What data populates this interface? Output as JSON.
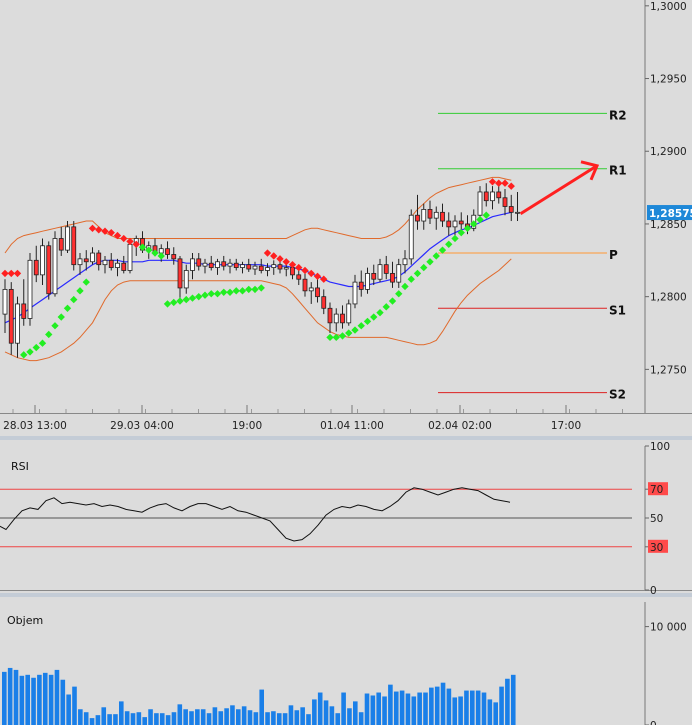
{
  "chart_data": [
    {
      "type": "candlestick",
      "panel": "price",
      "y_axis": {
        "ylim": [
          1.272,
          1.3004
        ],
        "ticks": [
          "1,3000",
          "1,2950",
          "1,2900",
          "1,2850",
          "1,2800",
          "1,2750"
        ],
        "grid": false
      },
      "x_axis": {
        "tick_labels": [
          "28.03 13:00",
          "29.03 04:00",
          "19:00",
          "01.04 11:00",
          "02.04 02:00",
          "17:00"
        ]
      },
      "current_price_label": "1,28575",
      "pivot_levels": [
        {
          "label": "R2",
          "value": 1.2926,
          "color": "#33cc33"
        },
        {
          "label": "R1",
          "value": 1.2888,
          "color": "#33cc33"
        },
        {
          "label": "P",
          "value": 1.283,
          "color": "#ff9933"
        },
        {
          "label": "S1",
          "value": 1.2792,
          "color": "#dd2222"
        },
        {
          "label": "S2",
          "value": 1.2734,
          "color": "#dd2222"
        }
      ],
      "candles": [
        [
          1.2788,
          1.2812,
          1.2775,
          1.2805
        ],
        [
          1.2805,
          1.281,
          1.276,
          1.2768
        ],
        [
          1.2768,
          1.28,
          1.2758,
          1.2795
        ],
        [
          1.2795,
          1.2812,
          1.278,
          1.2785
        ],
        [
          1.2785,
          1.283,
          1.278,
          1.2825
        ],
        [
          1.2825,
          1.2835,
          1.281,
          1.2815
        ],
        [
          1.2815,
          1.284,
          1.2808,
          1.2835
        ],
        [
          1.2835,
          1.2838,
          1.2798,
          1.2802
        ],
        [
          1.2802,
          1.2845,
          1.28,
          1.284
        ],
        [
          1.284,
          1.2848,
          1.2828,
          1.2832
        ],
        [
          1.2832,
          1.2852,
          1.283,
          1.2848
        ],
        [
          1.2848,
          1.2852,
          1.2818,
          1.2822
        ],
        [
          1.2822,
          1.283,
          1.2815,
          1.2826
        ],
        [
          1.2826,
          1.2832,
          1.2818,
          1.2824
        ],
        [
          1.2824,
          1.2834,
          1.2822,
          1.283
        ],
        [
          1.283,
          1.2832,
          1.2818,
          1.2822
        ],
        [
          1.2822,
          1.2828,
          1.2816,
          1.2825
        ],
        [
          1.2825,
          1.283,
          1.2818,
          1.282
        ],
        [
          1.282,
          1.2826,
          1.2814,
          1.2823
        ],
        [
          1.2823,
          1.2828,
          1.2816,
          1.2818
        ],
        [
          1.2818,
          1.284,
          1.2816,
          1.2836
        ],
        [
          1.2836,
          1.2842,
          1.2828,
          1.284
        ],
        [
          1.284,
          1.2845,
          1.283,
          1.2832
        ],
        [
          1.2832,
          1.2838,
          1.2826,
          1.2835
        ],
        [
          1.2835,
          1.284,
          1.2828,
          1.283
        ],
        [
          1.283,
          1.2836,
          1.2824,
          1.2833
        ],
        [
          1.2833,
          1.2838,
          1.2826,
          1.2829
        ],
        [
          1.2829,
          1.2834,
          1.2822,
          1.2826
        ],
        [
          1.2826,
          1.2828,
          1.2798,
          1.2806
        ],
        [
          1.2806,
          1.2822,
          1.2802,
          1.2818
        ],
        [
          1.2818,
          1.283,
          1.2812,
          1.2826
        ],
        [
          1.2826,
          1.283,
          1.2818,
          1.2821
        ],
        [
          1.2821,
          1.2826,
          1.2816,
          1.2823
        ],
        [
          1.2823,
          1.2828,
          1.2818,
          1.282
        ],
        [
          1.282,
          1.2826,
          1.2815,
          1.2824
        ],
        [
          1.2824,
          1.2828,
          1.2818,
          1.2821
        ],
        [
          1.2821,
          1.2826,
          1.2816,
          1.2823
        ],
        [
          1.2823,
          1.2826,
          1.2818,
          1.282
        ],
        [
          1.282,
          1.2824,
          1.2816,
          1.2822
        ],
        [
          1.2822,
          1.2826,
          1.2817,
          1.2819
        ],
        [
          1.2819,
          1.2824,
          1.2815,
          1.2821
        ],
        [
          1.2821,
          1.2826,
          1.2816,
          1.2818
        ],
        [
          1.2818,
          1.2823,
          1.2814,
          1.282
        ],
        [
          1.282,
          1.2825,
          1.2815,
          1.2822
        ],
        [
          1.2822,
          1.2826,
          1.2816,
          1.2819
        ],
        [
          1.2819,
          1.2823,
          1.2814,
          1.282
        ],
        [
          1.282,
          1.2824,
          1.2812,
          1.2815
        ],
        [
          1.2815,
          1.282,
          1.2808,
          1.2812
        ],
        [
          1.2812,
          1.2816,
          1.28,
          1.2804
        ],
        [
          1.2804,
          1.281,
          1.2795,
          1.2806
        ],
        [
          1.2806,
          1.2812,
          1.2796,
          1.28
        ],
        [
          1.28,
          1.2805,
          1.2788,
          1.2792
        ],
        [
          1.2792,
          1.2796,
          1.2775,
          1.2782
        ],
        [
          1.2782,
          1.2792,
          1.2776,
          1.2788
        ],
        [
          1.2788,
          1.2794,
          1.2778,
          1.2782
        ],
        [
          1.2782,
          1.2798,
          1.278,
          1.2795
        ],
        [
          1.2795,
          1.2815,
          1.2792,
          1.281
        ],
        [
          1.281,
          1.2818,
          1.28,
          1.2805
        ],
        [
          1.2805,
          1.282,
          1.2802,
          1.2816
        ],
        [
          1.2816,
          1.2822,
          1.2808,
          1.2812
        ],
        [
          1.2812,
          1.2826,
          1.281,
          1.2822
        ],
        [
          1.2822,
          1.2828,
          1.2812,
          1.2816
        ],
        [
          1.2816,
          1.2824,
          1.2806,
          1.281
        ],
        [
          1.281,
          1.2826,
          1.2806,
          1.2822
        ],
        [
          1.2822,
          1.2832,
          1.2816,
          1.2826
        ],
        [
          1.2826,
          1.286,
          1.2822,
          1.2856
        ],
        [
          1.2856,
          1.287,
          1.2846,
          1.2852
        ],
        [
          1.2852,
          1.2864,
          1.2846,
          1.286
        ],
        [
          1.286,
          1.2866,
          1.285,
          1.2854
        ],
        [
          1.2854,
          1.2862,
          1.2846,
          1.2858
        ],
        [
          1.2858,
          1.2864,
          1.2848,
          1.2852
        ],
        [
          1.2852,
          1.2858,
          1.2842,
          1.2848
        ],
        [
          1.2848,
          1.2856,
          1.2842,
          1.2852
        ],
        [
          1.2852,
          1.2858,
          1.2846,
          1.285
        ],
        [
          1.285,
          1.2856,
          1.2843,
          1.2847
        ],
        [
          1.2847,
          1.286,
          1.2845,
          1.2856
        ],
        [
          1.2856,
          1.2876,
          1.2852,
          1.2872
        ],
        [
          1.2872,
          1.2878,
          1.2862,
          1.2866
        ],
        [
          1.2866,
          1.2876,
          1.286,
          1.2872
        ],
        [
          1.2872,
          1.288,
          1.2864,
          1.2868
        ],
        [
          1.2868,
          1.2874,
          1.2856,
          1.2862
        ],
        [
          1.2862,
          1.287,
          1.2852,
          1.2858
        ],
        [
          1.2858,
          1.2872,
          1.2852,
          1.2858
        ]
      ],
      "series": [
        {
          "name": "MA",
          "color": "#2a2aff",
          "values": [
            1.2782,
            1.2784,
            1.2786,
            1.2789,
            1.2792,
            1.2795,
            1.2798,
            1.2801,
            1.2804,
            1.2807,
            1.281,
            1.2813,
            1.2816,
            1.2819,
            1.2822,
            1.2824,
            1.2825,
            1.2825,
            1.2825,
            1.2824,
            1.2824,
            1.2824,
            1.2824,
            1.2825,
            1.2825,
            1.2825,
            1.2825,
            1.2825,
            1.2824,
            1.2823,
            1.2823,
            1.2823,
            1.2822,
            1.2822,
            1.2822,
            1.2822,
            1.2822,
            1.2822,
            1.2822,
            1.2822,
            1.2822,
            1.2822,
            1.2821,
            1.2821,
            1.2821,
            1.2821,
            1.282,
            1.2819,
            1.2818,
            1.2816,
            1.2814,
            1.2812,
            1.281,
            1.2809,
            1.2808,
            1.2807,
            1.2807,
            1.2807,
            1.2808,
            1.2809,
            1.281,
            1.2811,
            1.2812,
            1.2814,
            1.2817,
            1.2821,
            1.2825,
            1.2829,
            1.2833,
            1.2836,
            1.2839,
            1.2842,
            1.2844,
            1.2846,
            1.2847,
            1.2849,
            1.2851,
            1.2853,
            1.2855,
            1.2856,
            1.2857,
            1.2858
          ]
        },
        {
          "name": "BB upper",
          "color": "#e06a2c",
          "values": [
            1.283,
            1.2836,
            1.284,
            1.2842,
            1.2843,
            1.2844,
            1.2845,
            1.2846,
            1.2847,
            1.2848,
            1.2849,
            1.285,
            1.2851,
            1.2852,
            1.2852,
            1.2848,
            1.2844,
            1.2842,
            1.284,
            1.284,
            1.284,
            1.284,
            1.284,
            1.284,
            1.284,
            1.284,
            1.284,
            1.284,
            1.284,
            1.284,
            1.284,
            1.284,
            1.284,
            1.284,
            1.284,
            1.284,
            1.284,
            1.284,
            1.284,
            1.284,
            1.284,
            1.284,
            1.284,
            1.284,
            1.284,
            1.284,
            1.2842,
            1.2844,
            1.2846,
            1.2847,
            1.2847,
            1.2846,
            1.2845,
            1.2844,
            1.2843,
            1.2842,
            1.2841,
            1.284,
            1.284,
            1.284,
            1.284,
            1.2841,
            1.2843,
            1.2846,
            1.285,
            1.2855,
            1.286,
            1.2864,
            1.2868,
            1.2871,
            1.2873,
            1.2875,
            1.2876,
            1.2877,
            1.2878,
            1.2879,
            1.288,
            1.2881,
            1.2882,
            1.2882,
            1.2881,
            1.288
          ]
        },
        {
          "name": "BB lower",
          "color": "#e06a2c",
          "values": [
            1.2762,
            1.276,
            1.2758,
            1.2757,
            1.2756,
            1.2756,
            1.2757,
            1.2758,
            1.276,
            1.2762,
            1.2765,
            1.2768,
            1.2772,
            1.2777,
            1.2782,
            1.279,
            1.2798,
            1.2804,
            1.2808,
            1.281,
            1.2811,
            1.2811,
            1.2811,
            1.2811,
            1.2811,
            1.2811,
            1.2811,
            1.2811,
            1.2811,
            1.2811,
            1.2811,
            1.2811,
            1.2811,
            1.2811,
            1.2811,
            1.2811,
            1.2811,
            1.2811,
            1.2811,
            1.2811,
            1.2811,
            1.2811,
            1.281,
            1.2809,
            1.2808,
            1.2806,
            1.2802,
            1.2797,
            1.2792,
            1.2787,
            1.2782,
            1.2779,
            1.2776,
            1.2774,
            1.2773,
            1.2772,
            1.2772,
            1.2772,
            1.2772,
            1.2772,
            1.2772,
            1.2772,
            1.2771,
            1.277,
            1.2769,
            1.2768,
            1.2767,
            1.2767,
            1.2768,
            1.277,
            1.2776,
            1.2783,
            1.279,
            1.2796,
            1.2801,
            1.2805,
            1.2809,
            1.2812,
            1.2815,
            1.2818,
            1.2822,
            1.2826
          ]
        },
        {
          "name": "Parabolic SAR",
          "color": "#ff2222|#22ee22",
          "values": [
            1.2816,
            1.2816,
            1.2816,
            1.276,
            1.2762,
            1.2765,
            1.2768,
            1.2774,
            1.278,
            1.2786,
            1.2792,
            1.2798,
            1.2804,
            1.281,
            1.2847,
            1.2846,
            1.2845,
            1.2844,
            1.2842,
            1.284,
            1.2838,
            1.2836,
            1.2834,
            1.2832,
            1.283,
            1.2828,
            1.2795,
            1.2796,
            1.2797,
            1.2798,
            1.2799,
            1.28,
            1.2801,
            1.2802,
            1.2802,
            1.2803,
            1.2803,
            1.2804,
            1.2804,
            1.2805,
            1.2805,
            1.2806,
            1.283,
            1.2828,
            1.2826,
            1.2824,
            1.2822,
            1.282,
            1.2818,
            1.2816,
            1.2814,
            1.2812,
            1.2772,
            1.2772,
            1.2773,
            1.2775,
            1.2777,
            1.278,
            1.2783,
            1.2786,
            1.2789,
            1.2793,
            1.2797,
            1.2802,
            1.2807,
            1.2812,
            1.2816,
            1.282,
            1.2824,
            1.2828,
            1.2832,
            1.2836,
            1.284,
            1.2844,
            1.2847,
            1.285,
            1.2853,
            1.2856,
            1.2879,
            1.2878,
            1.2878,
            1.2876
          ]
        }
      ]
    },
    {
      "type": "line",
      "panel": "rsi",
      "title": "RSI",
      "ylim": [
        0,
        100
      ],
      "y_ticks": [
        "100",
        "70",
        "50",
        "30",
        "0"
      ],
      "levels": [
        70,
        50,
        30
      ],
      "series": [
        {
          "name": "RSI",
          "color": "#111111",
          "values": [
            45,
            42,
            49,
            55,
            57,
            56,
            62,
            64,
            60,
            61,
            60,
            59,
            60,
            58,
            59,
            58,
            56,
            55,
            54,
            57,
            59,
            60,
            57,
            55,
            58,
            60,
            60,
            58,
            56,
            58,
            55,
            54,
            52,
            50,
            48,
            42,
            36,
            34,
            35,
            39,
            45,
            52,
            56,
            58,
            57,
            59,
            58,
            56,
            55,
            58,
            62,
            68,
            71,
            70,
            68,
            66,
            68,
            70,
            71,
            70,
            69,
            66,
            63,
            62,
            61
          ]
        }
      ]
    },
    {
      "type": "bar",
      "panel": "volume",
      "title": "Objem",
      "ylim": [
        0,
        12500
      ],
      "y_ticks": [
        "10 000",
        "0"
      ],
      "series": [
        {
          "name": "Objem",
          "color": "#1a7fe8",
          "values": [
            5400,
            5800,
            5600,
            5000,
            5100,
            4800,
            5100,
            5300,
            5100,
            5600,
            4600,
            3100,
            3900,
            1600,
            1300,
            700,
            1000,
            1800,
            1100,
            1100,
            2400,
            1400,
            1200,
            1300,
            800,
            1600,
            1200,
            1200,
            1000,
            1300,
            2100,
            1600,
            1400,
            1600,
            1600,
            1200,
            1800,
            1400,
            1700,
            2000,
            1600,
            1900,
            1500,
            1300,
            3600,
            1300,
            1400,
            1200,
            1200,
            2000,
            1500,
            1800,
            1100,
            2600,
            3300,
            2500,
            1900,
            1200,
            3300,
            1700,
            2400,
            1300,
            3200,
            3000,
            3300,
            2900,
            4100,
            3400,
            3500,
            3200,
            2900,
            3300,
            3300,
            3800,
            3900,
            4300,
            3700,
            2800,
            2900,
            3500,
            3500,
            3500,
            3300,
            2600,
            2300,
            3900,
            4700,
            5100
          ]
        }
      ]
    }
  ]
}
